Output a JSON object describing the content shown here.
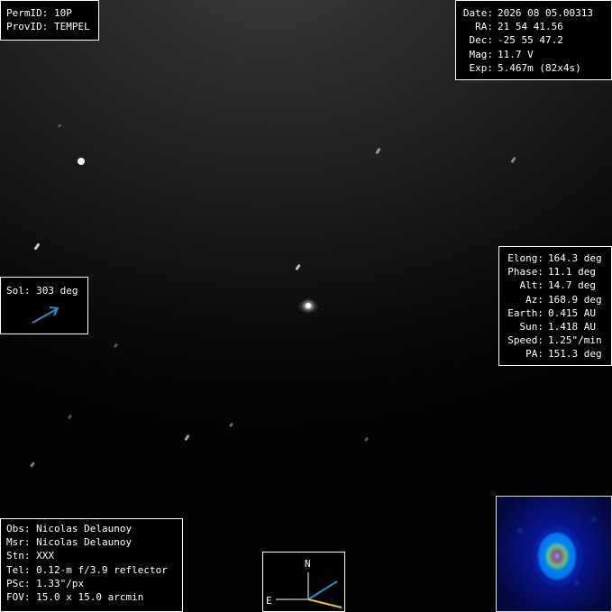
{
  "ids": [
    {
      "label": "PermID:",
      "value": "10P"
    },
    {
      "label": "ProvID:",
      "value": "TEMPEL"
    }
  ],
  "observation": [
    {
      "label": "Date:",
      "value": "2026 08 05.00313"
    },
    {
      "label": "RA:",
      "value": "21 54 41.56"
    },
    {
      "label": "Dec:",
      "value": "-25 55 47.2"
    },
    {
      "label": "Mag:",
      "value": "11.7 V"
    },
    {
      "label": "Exp:",
      "value": "5.467m (82x4s)"
    }
  ],
  "geometry": [
    {
      "label": "Elong:",
      "value": "164.3 deg"
    },
    {
      "label": "Phase:",
      "value": "11.1 deg"
    },
    {
      "label": "Alt:",
      "value": "14.7 deg"
    },
    {
      "label": "Az:",
      "value": "168.9 deg"
    },
    {
      "label": "Earth:",
      "value": "0.415 AU"
    },
    {
      "label": "Sun:",
      "value": "1.418 AU"
    },
    {
      "label": "Speed:",
      "value": "1.25\"/min"
    },
    {
      "label": "PA:",
      "value": "151.3 deg"
    }
  ],
  "sol": {
    "label": "Sol:",
    "value": "303 deg",
    "arrow_color": "#1f8fd0"
  },
  "station": [
    {
      "label": "Obs:",
      "value": "Nicolas Delaunoy"
    },
    {
      "label": "Msr:",
      "value": "Nicolas Delaunoy"
    },
    {
      "label": "Stn:",
      "value": "XXX"
    },
    {
      "label": "Tel:",
      "value": "0.12-m f/3.9 reflector"
    },
    {
      "label": "PSc:",
      "value": "1.33\"/px"
    },
    {
      "label": "FOV:",
      "value": "15.0 x 15.0 arcmin"
    }
  ],
  "compass": {
    "north": "N",
    "east": "E",
    "motion_color": "#1f8fd0",
    "sun_color": "#e8c53a"
  },
  "inset": {
    "colormap": "jet"
  }
}
